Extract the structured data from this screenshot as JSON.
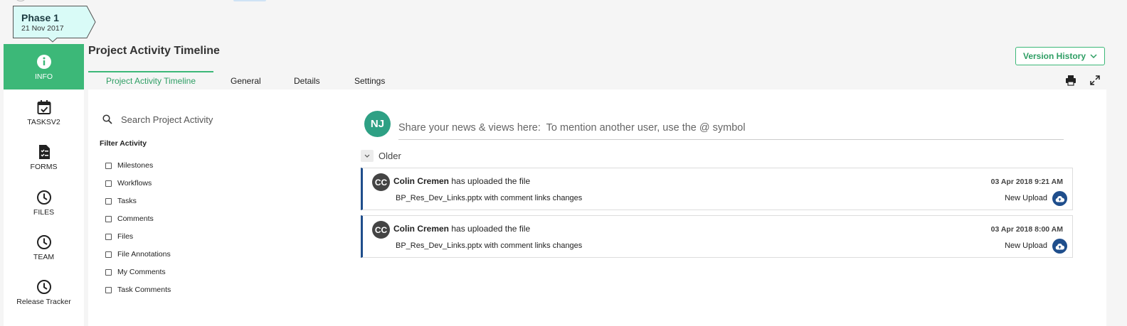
{
  "phase": {
    "title": "Phase 1",
    "date": "21 Nov 2017"
  },
  "sidebar": {
    "items": [
      {
        "label": "INFO",
        "icon": "info-icon",
        "active": true
      },
      {
        "label": "TASKSV2",
        "icon": "calendar-check-icon"
      },
      {
        "label": "FORMS",
        "icon": "form-document-icon"
      },
      {
        "label": "FILES",
        "icon": "clock-icon"
      },
      {
        "label": "TEAM",
        "icon": "clock-icon"
      },
      {
        "label": "Release Tracker",
        "icon": "clock-icon"
      }
    ]
  },
  "header": {
    "title": "Project Activity Timeline",
    "version_button": "Version History"
  },
  "tabs": [
    {
      "label": "Project Activity Timeline",
      "active": true
    },
    {
      "label": "General"
    },
    {
      "label": "Details"
    },
    {
      "label": "Settings"
    }
  ],
  "toolbar": {
    "icons": [
      "print-icon",
      "expand-icon"
    ]
  },
  "search": {
    "placeholder": "Search Project Activity"
  },
  "filter": {
    "title": "Filter Activity",
    "items": [
      "Milestones",
      "Workflows",
      "Tasks",
      "Comments",
      "Files",
      "File Annotations",
      "My Comments",
      "Task Comments"
    ]
  },
  "composer": {
    "avatar_initials": "NJ",
    "placeholder": "Share your news & views here:  To mention another user, use the @ symbol"
  },
  "older_label": "Older",
  "activities": [
    {
      "initials": "CC",
      "user": "Colin Cremen",
      "action": "has uploaded the file",
      "file_text": "BP_Res_Dev_Links.pptx with comment links changes",
      "timestamp": "03 Apr 2018 9:21 AM",
      "tag": "New Upload"
    },
    {
      "initials": "CC",
      "user": "Colin Cremen",
      "action": "has uploaded the file",
      "file_text": "BP_Res_Dev_Links.pptx with comment links changes",
      "timestamp": "03 Apr 2018 8:00 AM",
      "tag": "New Upload"
    }
  ],
  "colors": {
    "accent": "#3cb878",
    "card_border": "#1f4e8c",
    "phase_bg": "#d9fbf7"
  }
}
